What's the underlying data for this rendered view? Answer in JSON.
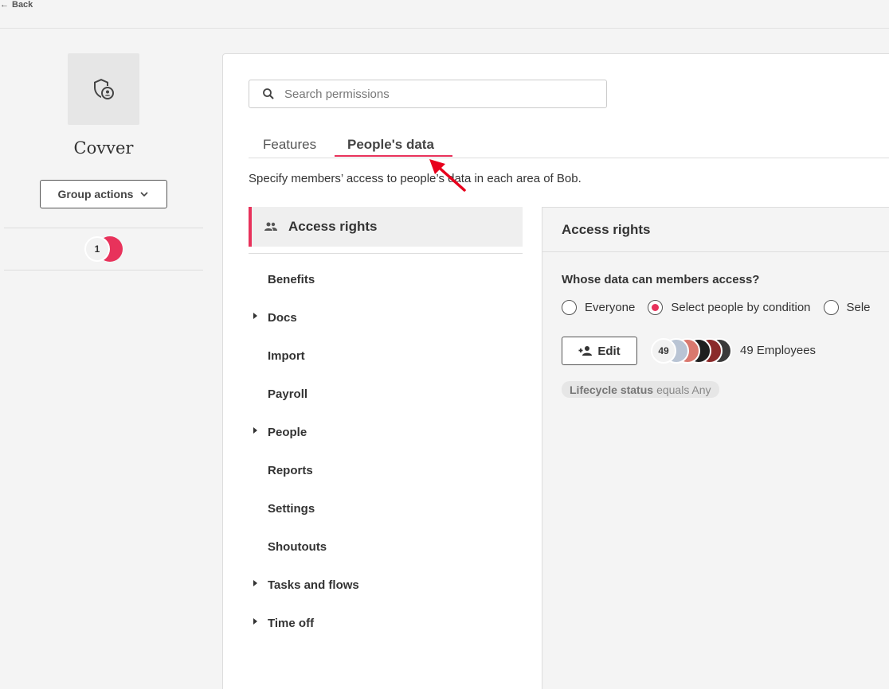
{
  "topbar": {
    "back_label": "Back"
  },
  "group": {
    "name": "Covver",
    "icon": "shield-person-icon",
    "actions_label": "Group actions",
    "member_count": "1"
  },
  "search": {
    "placeholder": "Search permissions",
    "value": ""
  },
  "tabs": [
    {
      "label": "Features",
      "active": false
    },
    {
      "label": "People's data",
      "active": true
    }
  ],
  "description": "Specify members’ access to people’s data in each area of Bob.",
  "categories": {
    "header": "Access rights",
    "items": [
      {
        "label": "Benefits",
        "expandable": false
      },
      {
        "label": "Docs",
        "expandable": true
      },
      {
        "label": "Import",
        "expandable": false
      },
      {
        "label": "Payroll",
        "expandable": false
      },
      {
        "label": "People",
        "expandable": true
      },
      {
        "label": "Reports",
        "expandable": false
      },
      {
        "label": "Settings",
        "expandable": false
      },
      {
        "label": "Shoutouts",
        "expandable": false
      },
      {
        "label": "Tasks and flows",
        "expandable": true
      },
      {
        "label": "Time off",
        "expandable": true
      }
    ]
  },
  "access_panel": {
    "title": "Access rights",
    "question": "Whose data can members access?",
    "options": [
      {
        "label": "Everyone",
        "selected": false
      },
      {
        "label": "Select people by condition",
        "selected": true
      },
      {
        "label": "Sele",
        "selected": false
      }
    ],
    "edit_label": "Edit",
    "avatar_count": "49",
    "employees_label": "49 Employees",
    "condition": {
      "field": "Lifecycle status",
      "rest": "equals Any"
    }
  },
  "colors": {
    "accent": "#e8325b",
    "annotation_arrow": "#e8001c"
  }
}
